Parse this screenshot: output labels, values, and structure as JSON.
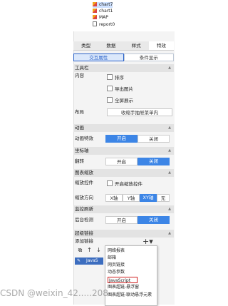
{
  "tree": {
    "items": [
      {
        "label": "chart7",
        "selected": true
      },
      {
        "label": "chart1",
        "selected": false
      },
      {
        "label": "MAP",
        "selected": false
      },
      {
        "label": "report0",
        "selected": false
      }
    ]
  },
  "panel": {
    "main_tabs": [
      "类型",
      "数据",
      "样式",
      "特效"
    ],
    "sub_tabs": [
      "交互属性",
      "条件显示"
    ],
    "sections": {
      "toolbar": "工具栏",
      "animation": "动画",
      "axis": "坐标轴",
      "zoom": "图表缩放",
      "monitor": "监控刷新",
      "hyperlink": "超级链接"
    },
    "labels": {
      "content": "内容",
      "layout": "布局",
      "anim_effect": "动画特效",
      "flip": "翻转",
      "zoom_control": "缩放控件",
      "zoom_dir": "缩放方向",
      "bg_detect": "后台检测",
      "add_link": "添加链接"
    },
    "toolbar_options": {
      "sort": "排序",
      "export": "导出图片",
      "fullscreen": "全屏展示"
    },
    "layout_button": "收缩手抽屉菜单内",
    "on": "开启",
    "off": "关闭",
    "zoom_enable": "开启缩放控件",
    "zoom_dirs": [
      "X轴",
      "Y轴",
      "XY轴",
      "无"
    ],
    "plus": "+▾",
    "list_row": "JavaS"
  },
  "menu": {
    "items": [
      "网络报表",
      "邮箱",
      "网页链接",
      "动态参数",
      "JavaScript",
      "图表超链-悬浮窗",
      "图表超链-联动悬浮元素"
    ]
  },
  "watermark": "CSDN @weixin_42.....208",
  "colors": {
    "accent": "#3c85e6",
    "highlight_border": "#d02020"
  }
}
